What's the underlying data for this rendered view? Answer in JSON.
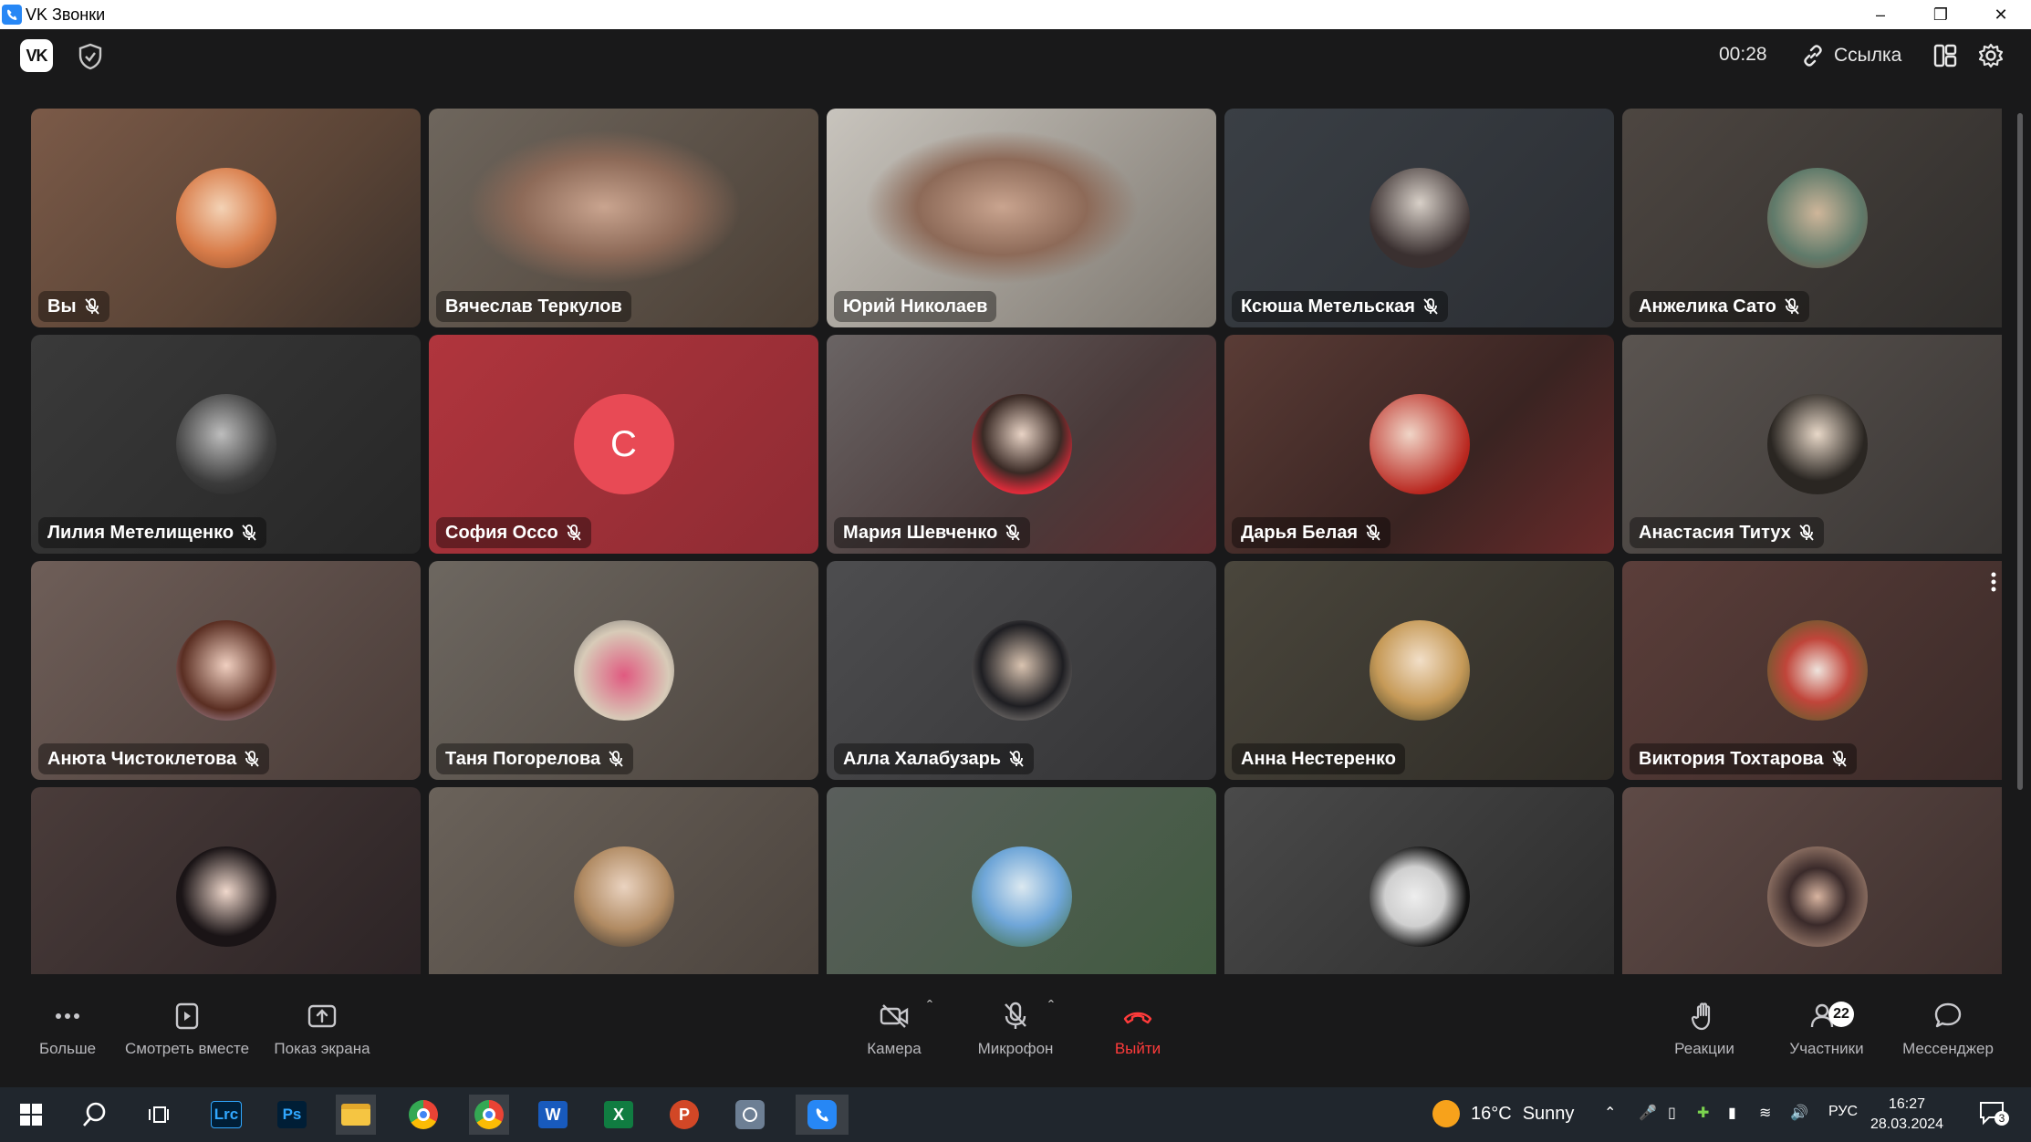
{
  "window": {
    "title": "VK Звонки"
  },
  "header": {
    "timer": "00:28",
    "link_label": "Ссылка"
  },
  "participants": [
    {
      "name": "Вы",
      "muted": true
    },
    {
      "name": "Вячеслав Теркулов",
      "muted": false
    },
    {
      "name": "Юрий Николаев",
      "muted": false
    },
    {
      "name": "Ксюша Метельская",
      "muted": true
    },
    {
      "name": "Анжелика Сато",
      "muted": true
    },
    {
      "name": "Лилия Метелищенко",
      "muted": true
    },
    {
      "name": "София Оссо",
      "muted": true,
      "initial": "С"
    },
    {
      "name": "Мария Шевченко",
      "muted": true
    },
    {
      "name": "Дарья Белая",
      "muted": true
    },
    {
      "name": "Анастасия Титух",
      "muted": true
    },
    {
      "name": "Анюта Чистоклетова",
      "muted": true
    },
    {
      "name": "Таня Погорелова",
      "muted": true
    },
    {
      "name": "Алла Халабузарь",
      "muted": true
    },
    {
      "name": "Анна Нестеренко",
      "muted": false
    },
    {
      "name": "Виктория Тохтарова",
      "muted": true
    }
  ],
  "toolbar": {
    "more": "Больше",
    "watch_together": "Смотреть вместе",
    "screen_share": "Показ экрана",
    "camera": "Камера",
    "microphone": "Микрофон",
    "leave": "Выйти",
    "reactions": "Реакции",
    "participants": "Участники",
    "participants_count": "22",
    "messenger": "Мессенджер"
  },
  "taskbar": {
    "weather_temp": "16°C",
    "weather_text": "Sunny",
    "language": "РУС",
    "time": "16:27",
    "date": "28.03.2024",
    "notifications": "3",
    "apps": [
      "start-icon",
      "search-icon",
      "task-view-icon",
      "lightroom-icon",
      "photoshop-icon",
      "file-explorer-icon",
      "chrome-icon",
      "chrome-profile-icon",
      "word-icon",
      "excel-icon",
      "powerpoint-icon",
      "app-icon",
      "vk-calls-icon"
    ]
  },
  "colors": {
    "accent_red": "#ff3b3b",
    "letter_avatar": "#e84a55",
    "vk_blue": "#2787f5"
  }
}
